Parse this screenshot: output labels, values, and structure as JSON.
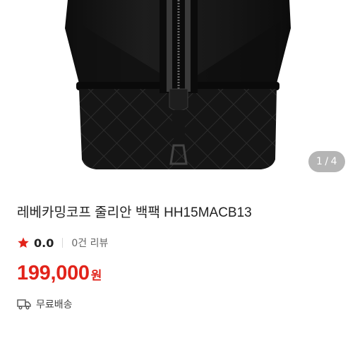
{
  "gallery": {
    "current_page": "1",
    "separator": "/",
    "total_pages": "4",
    "image_icon": "black-quilted-backpack-image"
  },
  "product": {
    "title": "레베카밍코프 줄리안 백팩 HH15MACB13",
    "rating_value": "0.0",
    "review_count": "0건 리뷰",
    "price": "199,000",
    "currency": "원",
    "shipping": "무료배송"
  },
  "icons": {
    "rating": "star-icon",
    "shipping": "truck-icon"
  },
  "colors": {
    "accent": "#e2231a",
    "star": "#e2231a",
    "text": "#222222",
    "muted": "#666666"
  }
}
